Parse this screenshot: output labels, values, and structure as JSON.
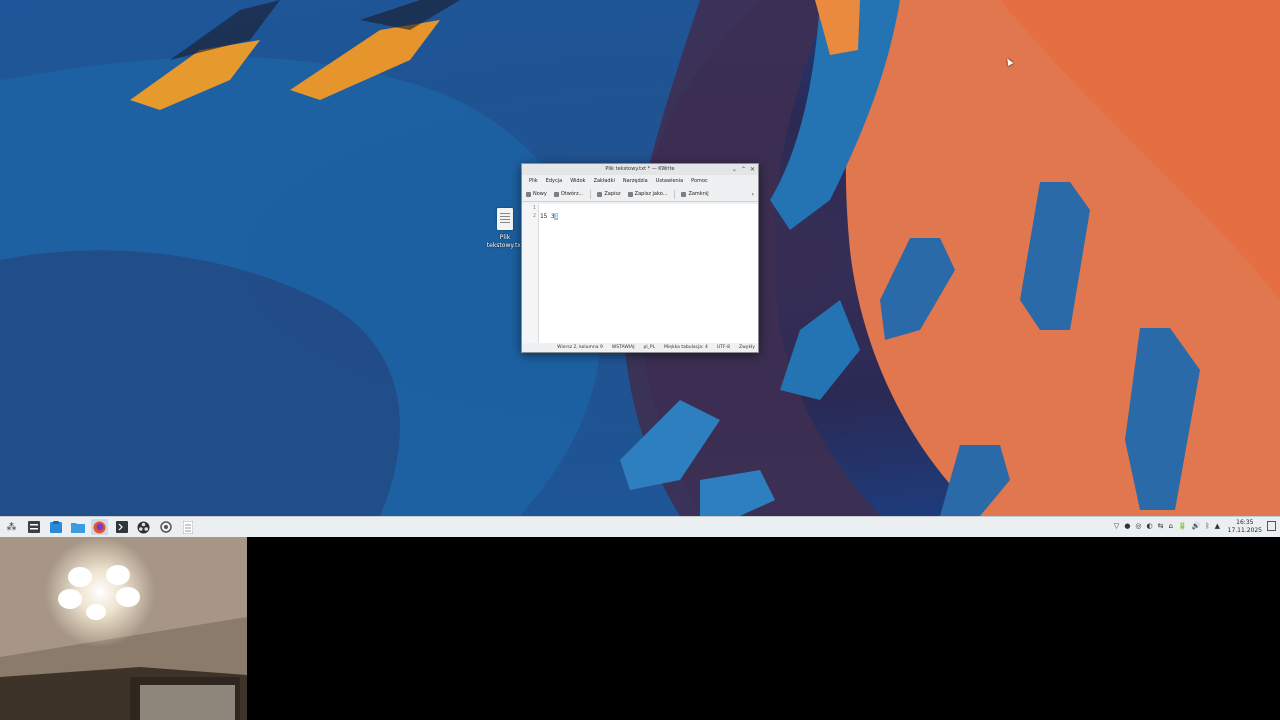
{
  "desktop": {
    "icon_label": "Plik tekstowy.txt"
  },
  "window": {
    "title": "Plik tekstowy.txt * — KWrite",
    "controls": {
      "minimize": "⌄",
      "maximize": "⌃",
      "close": "✕"
    },
    "menu": [
      "Plik",
      "Edycja",
      "Widok",
      "Zakładki",
      "Narzędzia",
      "Ustawienia",
      "Pomoc"
    ],
    "toolbar": {
      "new": "Nowy",
      "open": "Otwórz...",
      "save": "Zapisz",
      "save_as": "Zapisz jako...",
      "close": "Zamknij",
      "more": "›"
    },
    "editor": {
      "line_numbers": [
        "1",
        "2"
      ],
      "line2_text": "15 3",
      "line2_selected": "1"
    },
    "statusbar": {
      "position": "Wiersz 2, kolumna 9",
      "mode": "WSTAWIAJ",
      "language": "pl_PL",
      "indent": "Miękka tabulacja: 4",
      "encoding": "UTF-8",
      "syntax": "Zwykły"
    }
  },
  "taskbar": {
    "launcher": "⁂",
    "clock": {
      "time": "16:35",
      "date": "17.11.2025"
    },
    "tray": [
      "▽",
      "●",
      "◎",
      "◐",
      "⇆",
      "⌂",
      "🔋",
      "🔊",
      "ᛒ",
      "▲"
    ]
  }
}
